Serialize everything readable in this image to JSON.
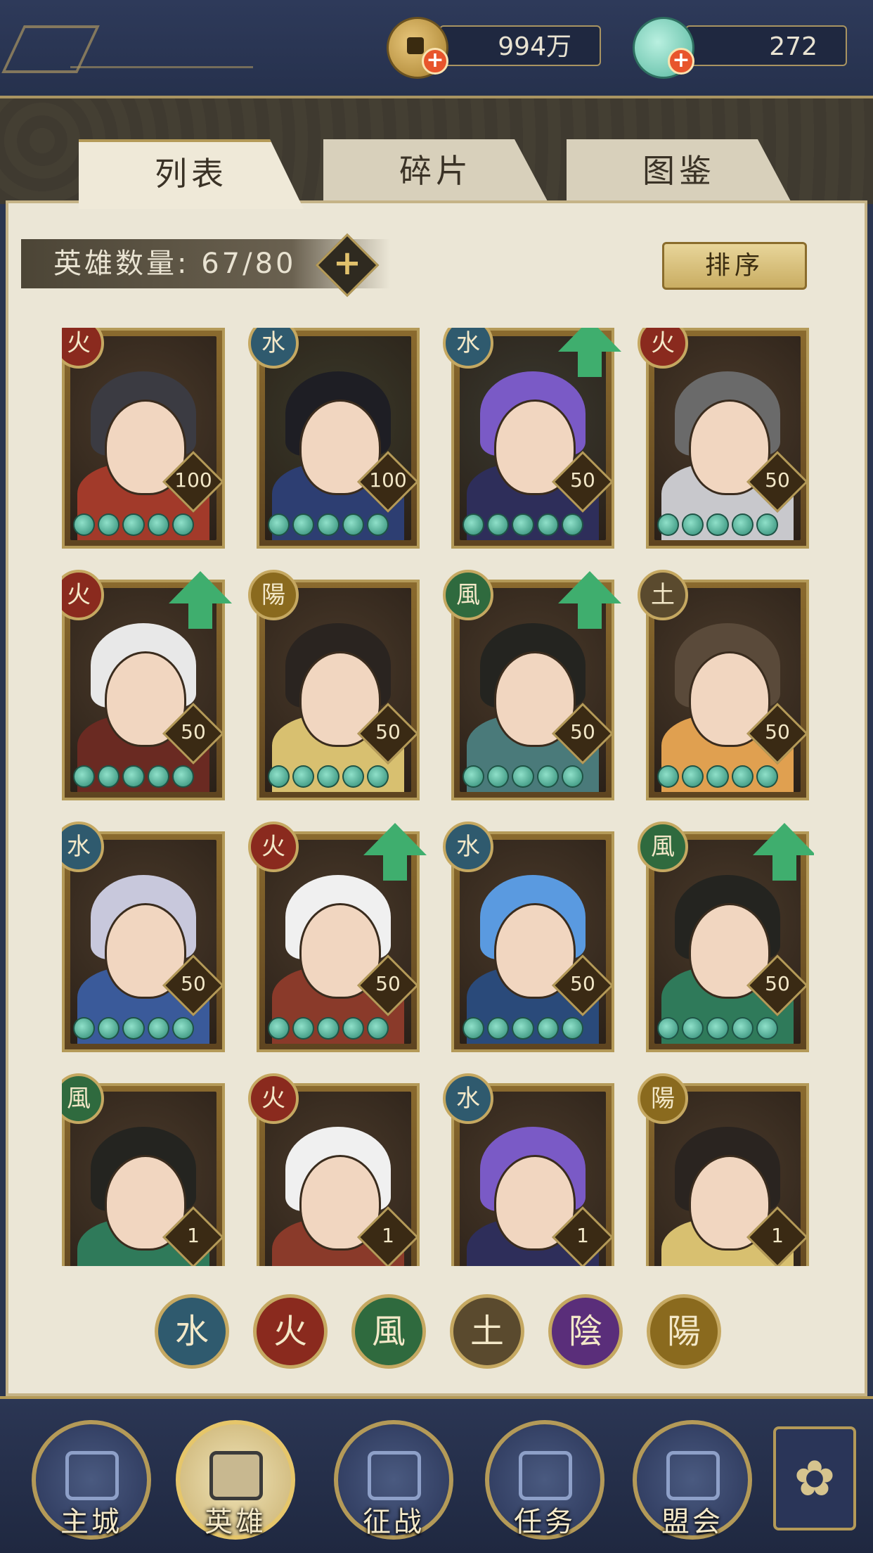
{
  "resources": {
    "coins": "994万",
    "shells": "272"
  },
  "tabs": [
    {
      "label": "列表",
      "active": true
    },
    {
      "label": "碎片",
      "active": false
    },
    {
      "label": "图鉴",
      "active": false
    }
  ],
  "hero_count": {
    "label": "英雄数量:",
    "value": "67/80"
  },
  "sort_label": "排序",
  "heroes": [
    {
      "element": "火",
      "level": "100",
      "upgrade": false
    },
    {
      "element": "水",
      "level": "100",
      "upgrade": false
    },
    {
      "element": "水",
      "level": "50",
      "upgrade": true
    },
    {
      "element": "火",
      "level": "50",
      "upgrade": false
    },
    {
      "element": "火",
      "level": "50",
      "upgrade": true
    },
    {
      "element": "陽",
      "level": "50",
      "upgrade": false
    },
    {
      "element": "風",
      "level": "50",
      "upgrade": true
    },
    {
      "element": "土",
      "level": "50",
      "upgrade": false
    },
    {
      "element": "水",
      "level": "50",
      "upgrade": false
    },
    {
      "element": "火",
      "level": "50",
      "upgrade": true
    },
    {
      "element": "水",
      "level": "50",
      "upgrade": false
    },
    {
      "element": "風",
      "level": "50",
      "upgrade": true
    },
    {
      "element": "風",
      "level": "1",
      "upgrade": false
    },
    {
      "element": "火",
      "level": "1",
      "upgrade": false
    },
    {
      "element": "水",
      "level": "1",
      "upgrade": false
    },
    {
      "element": "陽",
      "level": "1",
      "upgrade": false
    }
  ],
  "element_filters": [
    "水",
    "火",
    "風",
    "土",
    "陰",
    "陽"
  ],
  "element_colors": {
    "水": "#2f5a6e",
    "火": "#8a2a1e",
    "風": "#2f6a3e",
    "土": "#5a4a2e",
    "陰": "#5a2e7a",
    "陽": "#8a6a1e"
  },
  "nav": [
    {
      "label": "主城",
      "icon": "castle-icon",
      "active": false
    },
    {
      "label": "英雄",
      "icon": "hero-portrait-icon",
      "active": true
    },
    {
      "label": "征战",
      "icon": "scroll-icon",
      "active": false
    },
    {
      "label": "任务",
      "icon": "quest-icon",
      "active": false
    },
    {
      "label": "盟会",
      "icon": "guild-gate-icon",
      "active": false
    }
  ],
  "menu_icon": "menu-flower-icon"
}
